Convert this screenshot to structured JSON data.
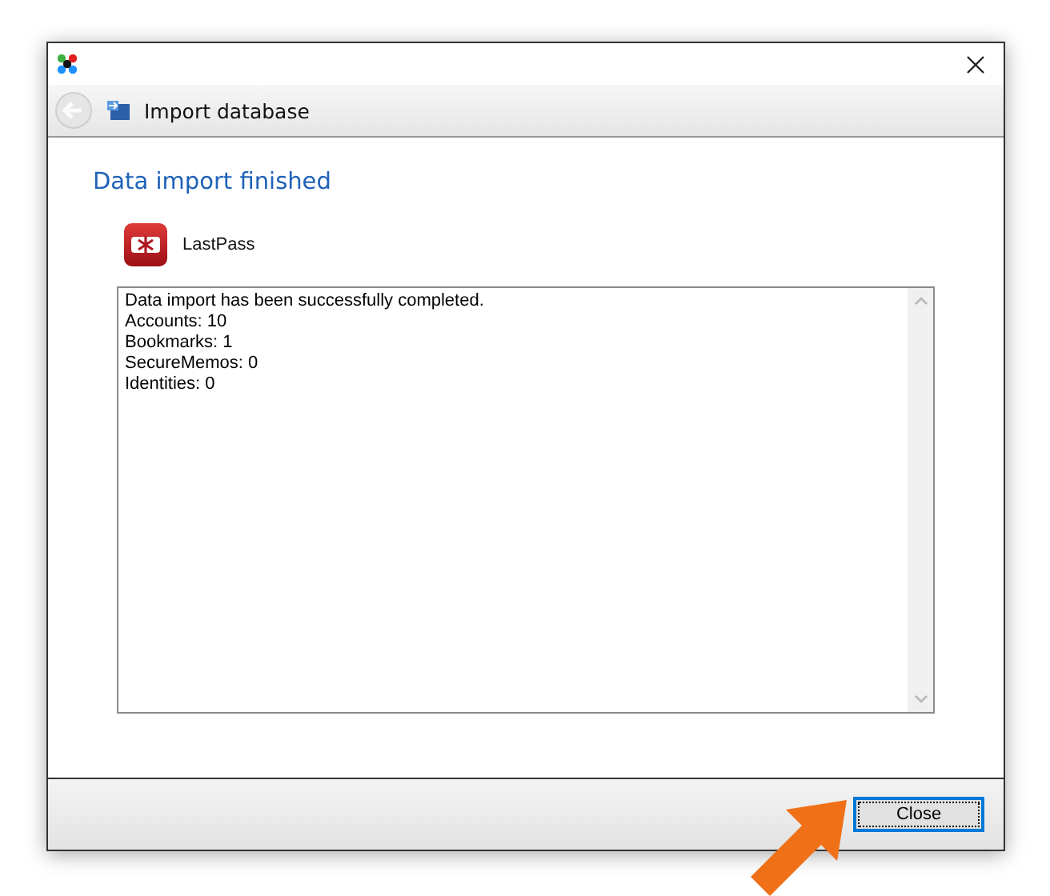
{
  "nav": {
    "back_disabled": true,
    "title": "Import database"
  },
  "heading": "Data import finished",
  "source": {
    "name": "LastPass"
  },
  "log_lines": [
    "Data import has been successfully completed.",
    "Accounts: 10",
    "Bookmarks: 1",
    "SecureMemos: 0",
    "Identities: 0"
  ],
  "buttons": [
    {
      "label": "Close",
      "focused": true
    }
  ]
}
